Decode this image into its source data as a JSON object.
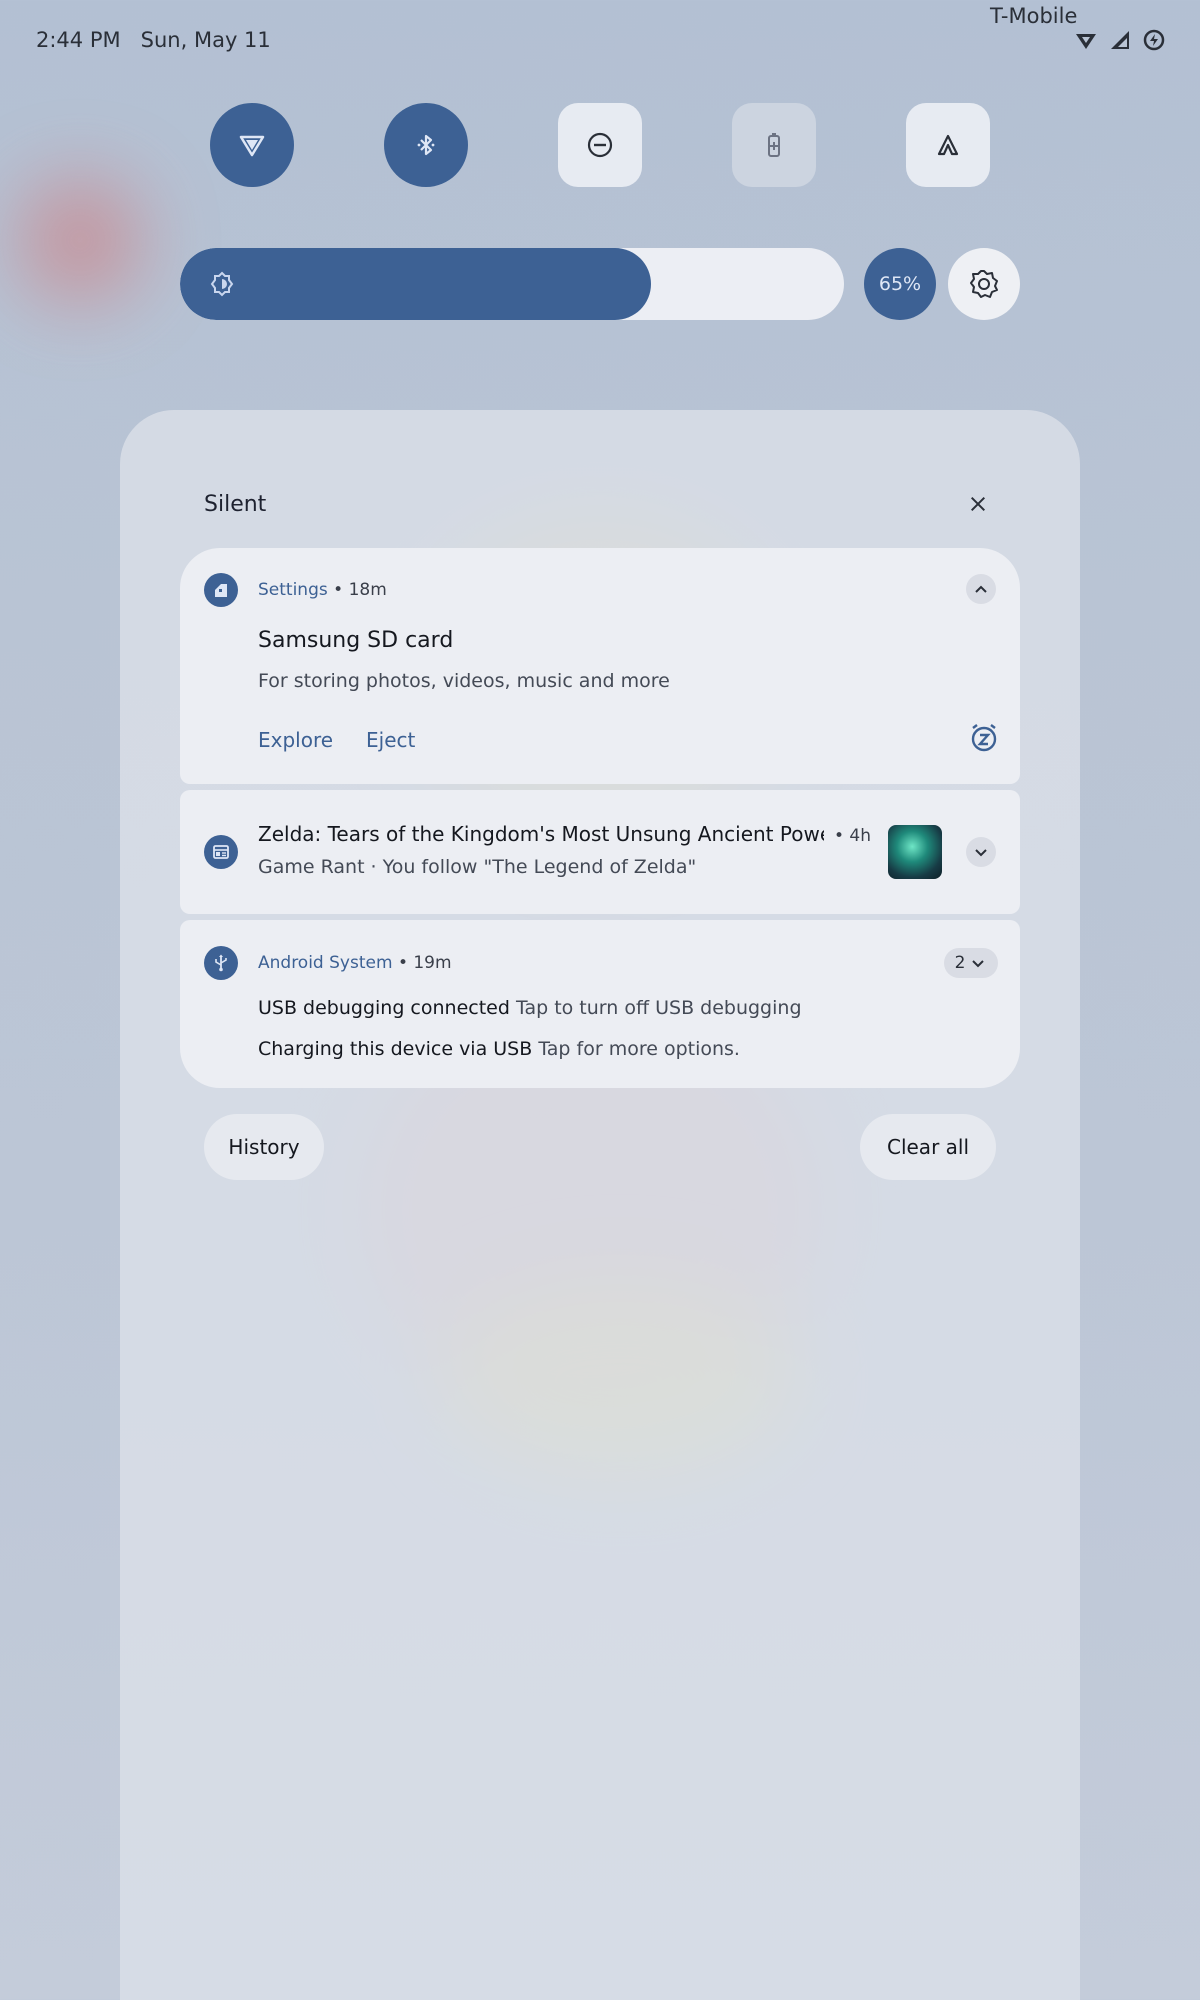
{
  "status_bar": {
    "time": "2:44 PM",
    "date": "Sun, May 11",
    "carrier": "T-Mobile",
    "icons": [
      "wifi-icon",
      "signal-icon",
      "battery-saver-icon"
    ]
  },
  "quick_tiles": [
    {
      "name": "vpn-tile",
      "icon": "vpn-shield-icon",
      "state": "on"
    },
    {
      "name": "bluetooth-tile",
      "icon": "bluetooth-icon",
      "state": "on"
    },
    {
      "name": "do-not-disturb-tile",
      "icon": "do-not-disturb-icon",
      "state": "off"
    },
    {
      "name": "battery-saver-tile",
      "icon": "battery-icon",
      "state": "unavailable"
    },
    {
      "name": "mode-tile",
      "icon": "mode-a-icon",
      "state": "off"
    }
  ],
  "brightness": {
    "level_fraction": 0.71,
    "percent_label": "65%"
  },
  "shade": {
    "section_label": "Silent",
    "history_label": "History",
    "clear_all_label": "Clear all"
  },
  "notifications": [
    {
      "app": "Settings",
      "time": "• 18m",
      "title": "Samsung SD card",
      "body": "For storing photos, videos, music and more",
      "actions": [
        "Explore",
        "Eject"
      ]
    },
    {
      "title": "Zelda: Tears of the Kingdom's Most Unsung Ancient Power May...",
      "time": "• 4h",
      "body": "Game Rant · You follow \"The Legend of Zelda\""
    },
    {
      "app": "Android System",
      "time": "• 19m",
      "count": "2",
      "line1_bold": "USB debugging connected",
      "line1_text": "Tap to turn off USB debugging",
      "line2_bold": "Charging this device via USB",
      "line2_text": "Tap for more options."
    }
  ],
  "colors": {
    "accent": "#3d6194",
    "card": "#eceef3",
    "panel": "#dbdfe8"
  }
}
